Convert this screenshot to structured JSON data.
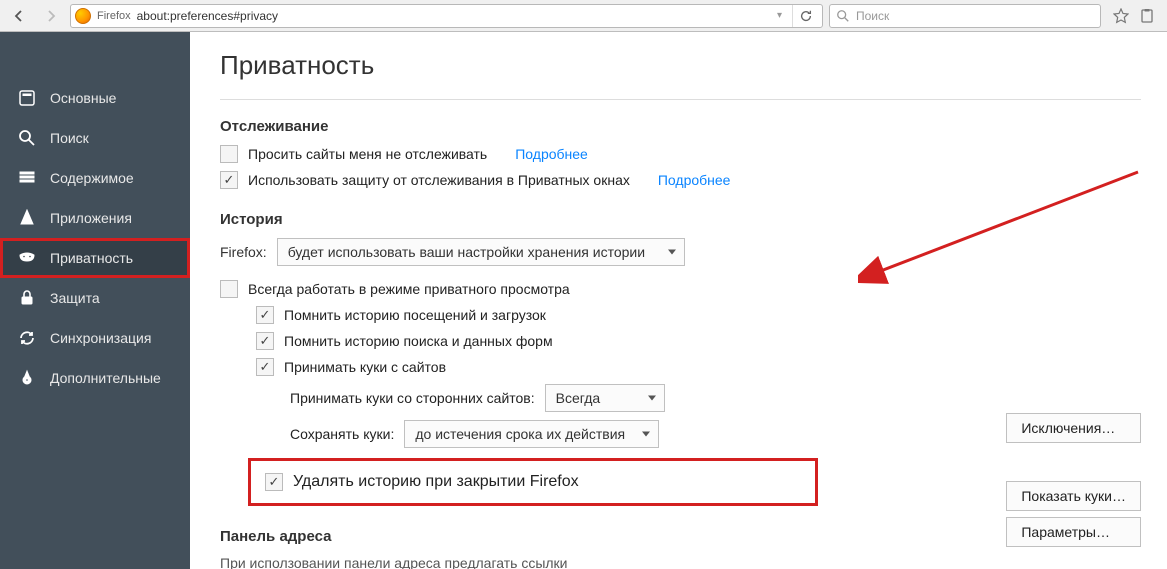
{
  "chrome": {
    "site_label": "Firefox",
    "url": "about:preferences#privacy",
    "search_placeholder": "Поиск"
  },
  "sidebar": {
    "items": [
      {
        "label": "Основные"
      },
      {
        "label": "Поиск"
      },
      {
        "label": "Содержимое"
      },
      {
        "label": "Приложения"
      },
      {
        "label": "Приватность"
      },
      {
        "label": "Защита"
      },
      {
        "label": "Синхронизация"
      },
      {
        "label": "Дополнительные"
      }
    ]
  },
  "page": {
    "title": "Приватность",
    "tracking": {
      "heading": "Отслеживание",
      "dnt_label": "Просить сайты меня не отслеживать",
      "dnt_more": "Подробнее",
      "protection_label": "Использовать защиту от отслеживания в Приватных окнах",
      "protection_more": "Подробнее"
    },
    "history": {
      "heading": "История",
      "firefox_label": "Firefox:",
      "mode_value": "будет использовать ваши настройки хранения истории",
      "always_private": "Всегда работать в режиме приватного просмотра",
      "remember_visits": "Помнить историю посещений и загрузок",
      "remember_search": "Помнить историю поиска и данных форм",
      "accept_cookies": "Принимать куки с сайтов",
      "third_party_label": "Принимать куки со сторонних сайтов:",
      "third_party_value": "Всегда",
      "keep_label": "Сохранять куки:",
      "keep_value": "до истечения срока их действия",
      "clear_on_close": "Удалять историю при закрытии Firefox",
      "btn_exceptions": "Исключения…",
      "btn_show_cookies": "Показать куки…",
      "btn_settings": "Параметры…"
    },
    "address_bar": {
      "heading": "Панель адреса",
      "cut": "При исползовании панели адреса предлагать ссылки"
    }
  }
}
